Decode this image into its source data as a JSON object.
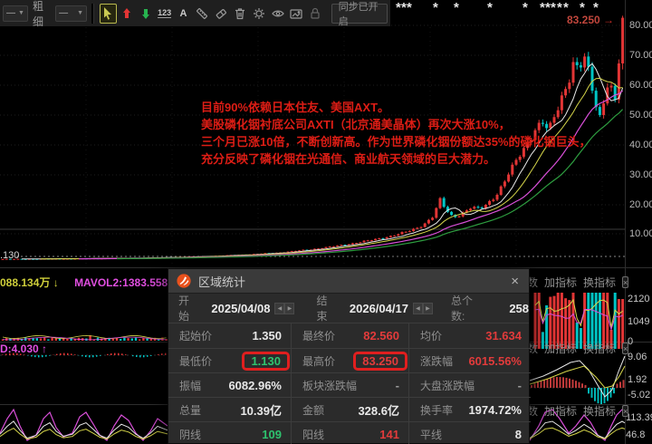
{
  "toolbar": {
    "line_style_value": "—",
    "thickness_label": "粗细",
    "thickness_value": "—",
    "numbers_tool_label": "123",
    "text_tool_label": "A",
    "sync_button_label": "同步已开启"
  },
  "chart": {
    "high_price_tag": "83.250",
    "high_price_arrow": "→",
    "low_price_label": ".130",
    "event_marker_glyph": "*",
    "price_axis_ticks": [
      "80.00",
      "70.00",
      "60.00",
      "50.00",
      "40.00",
      "30.00",
      "20.00",
      "10.00"
    ]
  },
  "volume_pane": {
    "mavol1_label": "088.134万 ↓",
    "mavol2_label": "MAVOL2:1383.558万 ↓",
    "axis_ticks": [
      "2120",
      "1049",
      "0"
    ]
  },
  "macd_pane": {
    "label": "D:4.030 ↑",
    "axis_ticks": [
      "9.06",
      "1.92",
      "-5.02"
    ]
  },
  "kdj_pane": {
    "axis_ticks": [
      "113.39",
      "46.8"
    ]
  },
  "pane_tabs": [
    "参数",
    "加指标",
    "换指标"
  ],
  "pane_close_glyph": "×",
  "annotation_lines": [
    "目前90%依赖日本住友、美国AXT。",
    "美股磷化铟衬底公司AXTI（北京通美晶体）再次大涨10%，",
    "三个月已涨10倍，不断创新高。作为世界磷化铟份额达35%的磷化铟巨头，",
    "充分反映了磷化铟在光通信、商业航天领域的巨大潜力。"
  ],
  "dialog": {
    "title": "区域统计",
    "close_glyph": "×",
    "start_label": "开始",
    "start_value": "2025/04/08",
    "end_label": "结束",
    "end_value": "2026/04/17",
    "count_label": "总个数:",
    "count_value": "258",
    "spin_left": "◀",
    "spin_right": "▶",
    "rows": [
      [
        {
          "label": "起始价",
          "value": "1.350",
          "color": "white"
        },
        {
          "label": "最终价",
          "value": "82.560",
          "color": "red"
        },
        {
          "label": "均价",
          "value": "31.634",
          "color": "red"
        }
      ],
      [
        {
          "label": "最低价",
          "value": "1.130",
          "color": "green",
          "boxed": true
        },
        {
          "label": "最高价",
          "value": "83.250",
          "color": "red",
          "boxed": true
        },
        {
          "label": "涨跌幅",
          "value": "6015.56%",
          "color": "red"
        }
      ],
      [
        {
          "label": "振幅",
          "value": "6082.96%",
          "color": "white"
        },
        {
          "label": "板块涨跌幅",
          "value": "-",
          "color": "gray"
        },
        {
          "label": "大盘涨跌幅",
          "value": "-",
          "color": "gray"
        }
      ],
      [
        {
          "label": "总量",
          "value": "10.39亿",
          "color": "white"
        },
        {
          "label": "金额",
          "value": "328.6亿",
          "color": "white"
        },
        {
          "label": "换手率",
          "value": "1974.72%",
          "color": "white"
        }
      ],
      [
        {
          "label": "阴线",
          "value": "109",
          "color": "green"
        },
        {
          "label": "阳线",
          "value": "141",
          "color": "red"
        },
        {
          "label": "平线",
          "value": "8",
          "color": "white"
        }
      ]
    ]
  },
  "colors": {
    "up": "#e23535",
    "down": "#00c5c5",
    "ma_white": "#e8e8e8",
    "ma_yellow": "#d6d64a",
    "ma_magenta": "#d94fd9",
    "ma_green": "#2e9e40",
    "annotation_red": "#dd1d15",
    "highlight_box": "#e01f1f"
  },
  "chart_data": {
    "type": "candlestick",
    "title": "区域统计 2025/04/08 - 2026/04/17",
    "ylim": [
      0,
      85
    ],
    "y_axis_ticks": [
      80,
      70,
      60,
      50,
      40,
      30,
      20,
      10
    ],
    "summary": {
      "start_price": 1.35,
      "end_price": 82.56,
      "low": 1.13,
      "high": 83.25,
      "avg": 31.634,
      "change_pct": "6015.56%",
      "bars": 258
    },
    "price_anchors": [
      [
        0,
        1.25
      ],
      [
        60,
        1.35
      ],
      [
        120,
        1.5
      ],
      [
        160,
        1.65
      ],
      [
        200,
        1.95
      ],
      [
        240,
        2.35
      ],
      [
        280,
        2.9
      ],
      [
        310,
        3.5
      ],
      [
        330,
        4.1
      ],
      [
        350,
        4.8
      ],
      [
        370,
        5.6
      ],
      [
        390,
        6.6
      ],
      [
        410,
        7.6
      ],
      [
        425,
        8.6
      ],
      [
        440,
        9.6
      ],
      [
        455,
        11
      ],
      [
        468,
        13
      ],
      [
        478,
        15.5
      ],
      [
        486,
        21
      ],
      [
        492,
        18
      ],
      [
        500,
        15.5
      ],
      [
        510,
        16.5
      ],
      [
        520,
        18.5
      ],
      [
        530,
        18
      ],
      [
        540,
        20.5
      ],
      [
        548,
        23
      ],
      [
        556,
        26.5
      ],
      [
        562,
        30
      ],
      [
        568,
        33
      ],
      [
        575,
        37
      ],
      [
        583,
        41
      ],
      [
        591,
        45
      ],
      [
        599,
        47
      ],
      [
        606,
        44
      ],
      [
        613,
        50
      ],
      [
        620,
        56
      ],
      [
        627,
        61
      ],
      [
        633,
        67
      ],
      [
        639,
        64
      ],
      [
        645,
        69
      ],
      [
        651,
        63
      ],
      [
        657,
        55
      ],
      [
        663,
        49
      ],
      [
        668,
        57
      ],
      [
        672,
        62
      ],
      [
        676,
        57
      ],
      [
        680,
        53
      ],
      [
        684,
        70
      ],
      [
        688,
        82.6
      ]
    ],
    "marker_xs": [
      437,
      443,
      449,
      478,
      501,
      538,
      577,
      596,
      602,
      608,
      615,
      622,
      640,
      655
    ]
  }
}
